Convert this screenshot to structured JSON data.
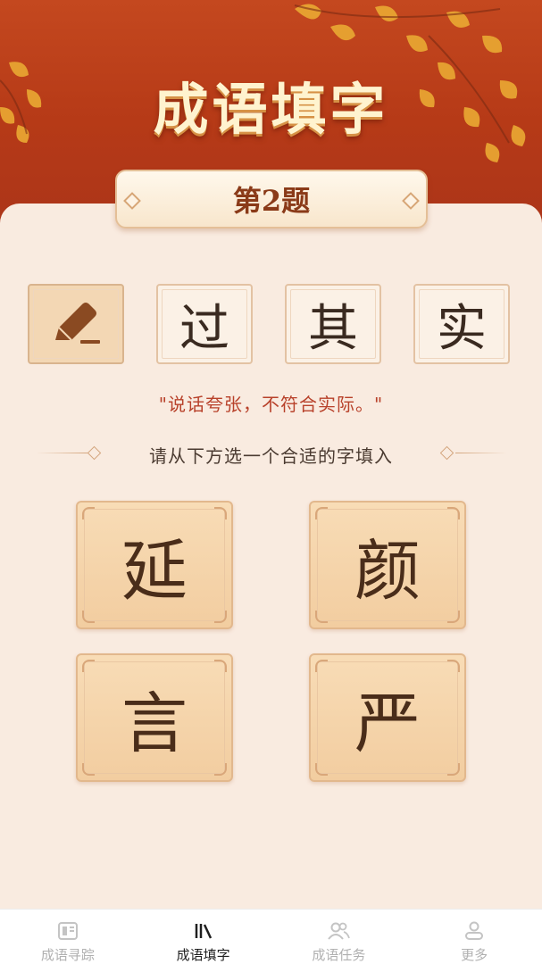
{
  "header": {
    "title": "成语填字"
  },
  "question": {
    "label": "第2题",
    "slots": [
      {
        "char": "",
        "blank": true,
        "icon": "pencil-icon"
      },
      {
        "char": "过",
        "blank": false
      },
      {
        "char": "其",
        "blank": false
      },
      {
        "char": "实",
        "blank": false
      }
    ],
    "meaning": "\"说话夸张，不符合实际。\"",
    "hint": "请从下方选一个合适的字填入"
  },
  "options": [
    "延",
    "颜",
    "言",
    "严"
  ],
  "nav": {
    "items": [
      {
        "label": "成语寻踪",
        "icon": "book-icon",
        "active": false
      },
      {
        "label": "成语填字",
        "icon": "bars-icon",
        "active": true
      },
      {
        "label": "成语任务",
        "icon": "users-icon",
        "active": false
      },
      {
        "label": "更多",
        "icon": "profile-icon",
        "active": false
      }
    ]
  },
  "colors": {
    "header_red": "#b63a17",
    "panel_bg": "#f9ebe0",
    "option_bg": "#f2cda0",
    "meaning_text": "#b8412a",
    "nav_active": "#1f1f1f",
    "nav_inactive": "#b0b0b0"
  }
}
